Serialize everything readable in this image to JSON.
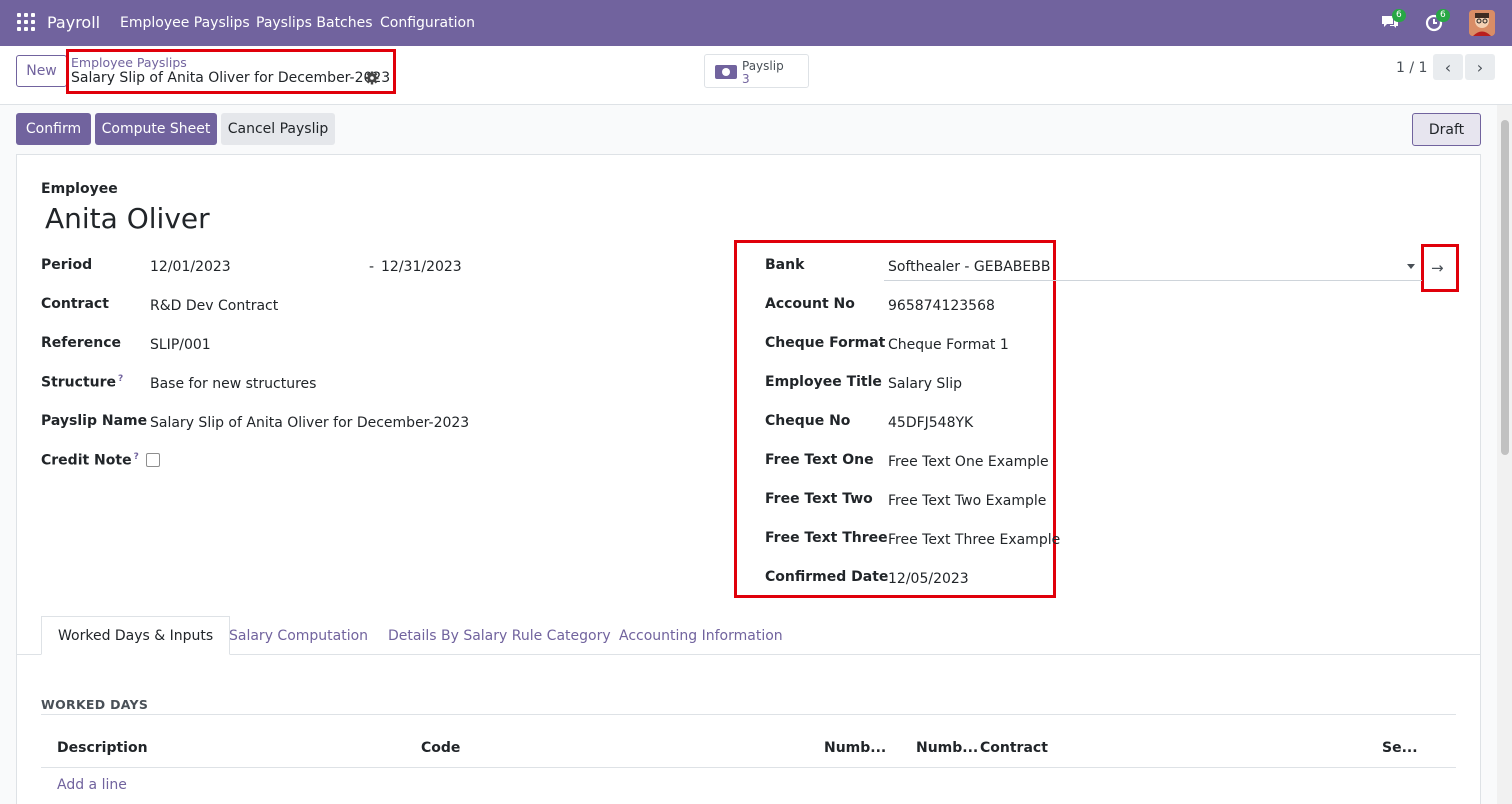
{
  "navbar": {
    "brand": "Payroll",
    "menu": [
      "Employee Payslips",
      "Payslips Batches",
      "Configuration"
    ],
    "messages_badge": "6",
    "activities_badge": "6"
  },
  "control_panel": {
    "new_label": "New",
    "breadcrumb": "Employee Payslips",
    "record_title": "Salary Slip of Anita Oliver for December-2023",
    "smart_button": {
      "label": "Payslip",
      "count": "3"
    },
    "pager": "1 / 1"
  },
  "statusbar": {
    "confirm": "Confirm",
    "compute": "Compute Sheet",
    "cancel": "Cancel Payslip",
    "status": "Draft"
  },
  "form": {
    "employee_label": "Employee",
    "employee_name": "Anita Oliver",
    "left_fields": [
      {
        "label": "Period",
        "value": "12/01/2023",
        "value2": "12/31/2023",
        "separator": "-"
      },
      {
        "label": "Contract",
        "value": "R&D Dev Contract"
      },
      {
        "label": "Reference",
        "value": "SLIP/001"
      },
      {
        "label": "Structure",
        "value": "Base for new structures",
        "help": "?"
      },
      {
        "label": "Payslip Name",
        "value": "Salary Slip of Anita Oliver for December-2023"
      },
      {
        "label": "Credit Note",
        "help": "?",
        "checked": false
      }
    ],
    "right_fields": [
      {
        "label": "Bank",
        "value": "Softhealer - GEBABEBB"
      },
      {
        "label": "Account No",
        "value": "965874123568"
      },
      {
        "label": "Cheque Format",
        "value": "Cheque Format 1"
      },
      {
        "label": "Employee Title",
        "value": "Salary Slip"
      },
      {
        "label": "Cheque No",
        "value": "45DFJ548YK"
      },
      {
        "label": "Free Text One",
        "value": "Free Text One Example"
      },
      {
        "label": "Free Text Two",
        "value": "Free Text Two Example"
      },
      {
        "label": "Free Text Three",
        "value": "Free Text Three Example"
      },
      {
        "label": "Confirmed Date",
        "value": "12/05/2023"
      }
    ]
  },
  "tabs": [
    "Worked Days & Inputs",
    "Salary Computation",
    "Details By Salary Rule Category",
    "Accounting Information"
  ],
  "worked_days": {
    "title": "WORKED DAYS",
    "columns": [
      "Description",
      "Code",
      "Numb...",
      "Numb...",
      "Contract",
      "Se..."
    ],
    "add_line": "Add a line"
  },
  "colors": {
    "brand": "#71639e",
    "highlight": "#e0000a"
  }
}
